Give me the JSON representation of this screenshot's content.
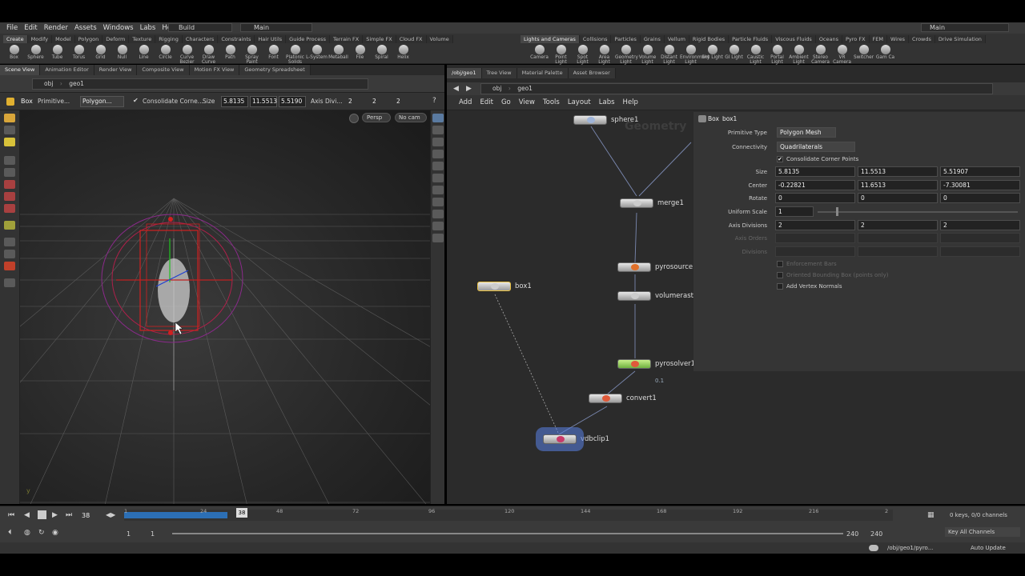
{
  "menubar": {
    "items": [
      "File",
      "Edit",
      "Render",
      "Assets",
      "Windows",
      "Labs",
      "Help"
    ],
    "desktop": "Build",
    "main": "Main",
    "main_right": "Main"
  },
  "shelf_left": {
    "tabs": [
      "Create",
      "Modify",
      "Model",
      "Polygon",
      "Deform",
      "Texture",
      "Rigging",
      "Characters",
      "Constraints",
      "Hair Utils",
      "Guide Process",
      "Terrain FX",
      "Simple FX",
      "Cloud FX",
      "Volume"
    ],
    "tools": [
      "Box",
      "Sphere",
      "Tube",
      "Torus",
      "Grid",
      "Null",
      "Line",
      "Circle",
      "Curve Bezier",
      "Draw Curve",
      "Path",
      "Spray Paint",
      "Font",
      "Platonic Solids",
      "L-System",
      "Metaball",
      "File",
      "Spiral",
      "Helix"
    ]
  },
  "shelf_right": {
    "tabs": [
      "Lights and Cameras",
      "Collisions",
      "Particles",
      "Grains",
      "Vellum",
      "Rigid Bodies",
      "Particle Fluids",
      "Viscous Fluids",
      "Oceans",
      "Pyro FX",
      "FEM",
      "Wires",
      "Crowds",
      "Drive Simulation"
    ],
    "tools": [
      "Camera",
      "Point Light",
      "Spot Light",
      "Area Light",
      "Geometry Light",
      "Volume Light",
      "Distant Light",
      "Environment Light",
      "Sky Light",
      "GI Light",
      "Caustic Light",
      "Portal Light",
      "Ambient Light",
      "Stereo Camera",
      "VR Camera",
      "Switcher",
      "Gam Ca"
    ]
  },
  "left_pane": {
    "tabs": [
      "Scene View",
      "Animation Editor",
      "Render View",
      "Composite View",
      "Motion FX View",
      "Geometry Spreadsheet"
    ],
    "path": [
      "obj",
      "geo1"
    ],
    "op_name": "Box",
    "op_fields": {
      "primitive": "Primitive...",
      "type": "Polygon...",
      "consolidate": "Consolidate Corne...",
      "size_label": "Size",
      "size": [
        "5.8135",
        "11.5513",
        "5.5190"
      ],
      "axis_label": "Axis Divi...",
      "axis": [
        "2",
        "2",
        "2"
      ]
    },
    "persp": "Persp",
    "nocam": "No cam"
  },
  "right_pane": {
    "tabs": [
      "/obj/geo1",
      "Tree View",
      "Material Palette",
      "Asset Browser"
    ],
    "path": [
      "obj",
      "geo1"
    ],
    "menu": [
      "Add",
      "Edit",
      "Go",
      "View",
      "Tools",
      "Layout",
      "Labs",
      "Help"
    ],
    "watermark": "Geometry"
  },
  "nodes": [
    {
      "name": "sphere1",
      "color": "#9fb4d8"
    },
    {
      "name": "merge1",
      "color": "#cccccc"
    },
    {
      "name": "pyrosource1",
      "color": "#e0702a"
    },
    {
      "name": "volumeraste",
      "color": "#cccccc"
    },
    {
      "name": "box1",
      "color": "#cccccc"
    },
    {
      "name": "pyrosolver1",
      "color": "#e05a3a"
    },
    {
      "name": "convert1",
      "color": "#e05a3a"
    },
    {
      "name": "vdbclip1",
      "color": "#c83a6a"
    }
  ],
  "node_extra": {
    "pyrosolver_value": "0.1"
  },
  "params": {
    "op_type": "Box",
    "op_name": "box1",
    "primitive_type_label": "Primitive Type",
    "primitive_type": "Polygon Mesh",
    "connectivity_label": "Connectivity",
    "connectivity": "Quadrilaterals",
    "consolidate": "Consolidate Corner Points",
    "size_label": "Size",
    "size": [
      "5.8135",
      "11.5513",
      "5.51907"
    ],
    "center_label": "Center",
    "center": [
      "-0.22821",
      "11.6513",
      "-7.30081"
    ],
    "rotate_label": "Rotate",
    "rotate": [
      "0",
      "0",
      "0"
    ],
    "uniform_scale_label": "Uniform Scale",
    "uniform_scale": "1",
    "axis_div_label": "Axis Divisions",
    "axis_div": [
      "2",
      "2",
      "2"
    ],
    "axis_orders_label": "Axis Orders",
    "divisions_label": "Divisions",
    "enforcement_bars": "Enforcement Bars",
    "oriented_bbox": "Oriented Bounding Box (points only)",
    "add_vertex_normals": "Add Vertex Normals"
  },
  "timeline": {
    "current_frame": "38",
    "ticks": [
      "1",
      "24",
      "48",
      "72",
      "96",
      "120",
      "144",
      "168",
      "192",
      "216",
      "2"
    ],
    "start": "1",
    "start2": "1",
    "end": "240",
    "end2": "240",
    "keys": "0 keys, 0/0 channels",
    "key_all": "Key All Channels",
    "progress": 0.134
  },
  "status": {
    "path": "/obj/geo1/pyro...",
    "update": "Auto Update"
  }
}
